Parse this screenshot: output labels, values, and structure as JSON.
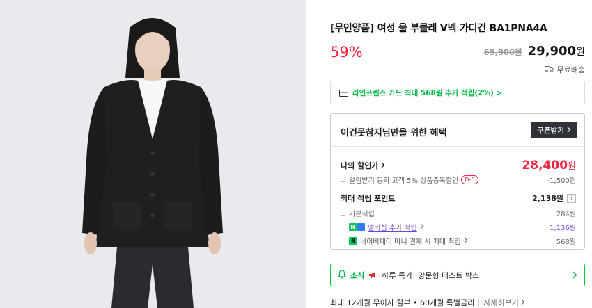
{
  "product": {
    "title": "[무인양품] 여성 울 부클레 V넥 가디건 BA1PNA4A",
    "discount_rate": "59%",
    "original_price": "69,900원",
    "sale_price_number": "29,900",
    "price_unit": "원",
    "shipping": "무료배송"
  },
  "card_promo": {
    "text": "라인프렌즈 카드 최대 568원 추가 적립(2%) >"
  },
  "benefit": {
    "title": "이건못참지님만을 위한 혜택",
    "coupon_button": "쿠폰받기",
    "my_discount_label": "나의 할인가",
    "my_price_number": "28,400",
    "my_price_unit": "원",
    "alert_discount_label": "알림받기 동의 고객 5% 상품중복할인",
    "alert_discount_badge": "D-5",
    "alert_discount_value": "-1,500원",
    "max_points_label": "최대 적립 포인트",
    "max_points_value": "2,138원",
    "help_mark": "?",
    "basic_points_label": "기본적립",
    "basic_points_value": "284원",
    "membership_label": "멤버십 추가 적립",
    "membership_value": "1,136원",
    "npay_label": "네이버페이 머니 결제 시 최대 적립",
    "npay_value": "568원"
  },
  "notice": {
    "tag": "소식",
    "text": "하루 특가! 양문형 더스트 박스"
  },
  "installment": {
    "text": "최대 12개월 무이자 할부 • 60개월 특별금리",
    "more": "자세히보기"
  },
  "colors": {
    "accent_red": "#f0253f",
    "naver_green": "#00c73c",
    "membership_purple": "#6b47d7",
    "coupon_button_bg": "#2f3337"
  },
  "icons": [
    "card-icon",
    "truck-icon",
    "bell-icon",
    "megaphone-icon",
    "chevron-right-icon"
  ]
}
